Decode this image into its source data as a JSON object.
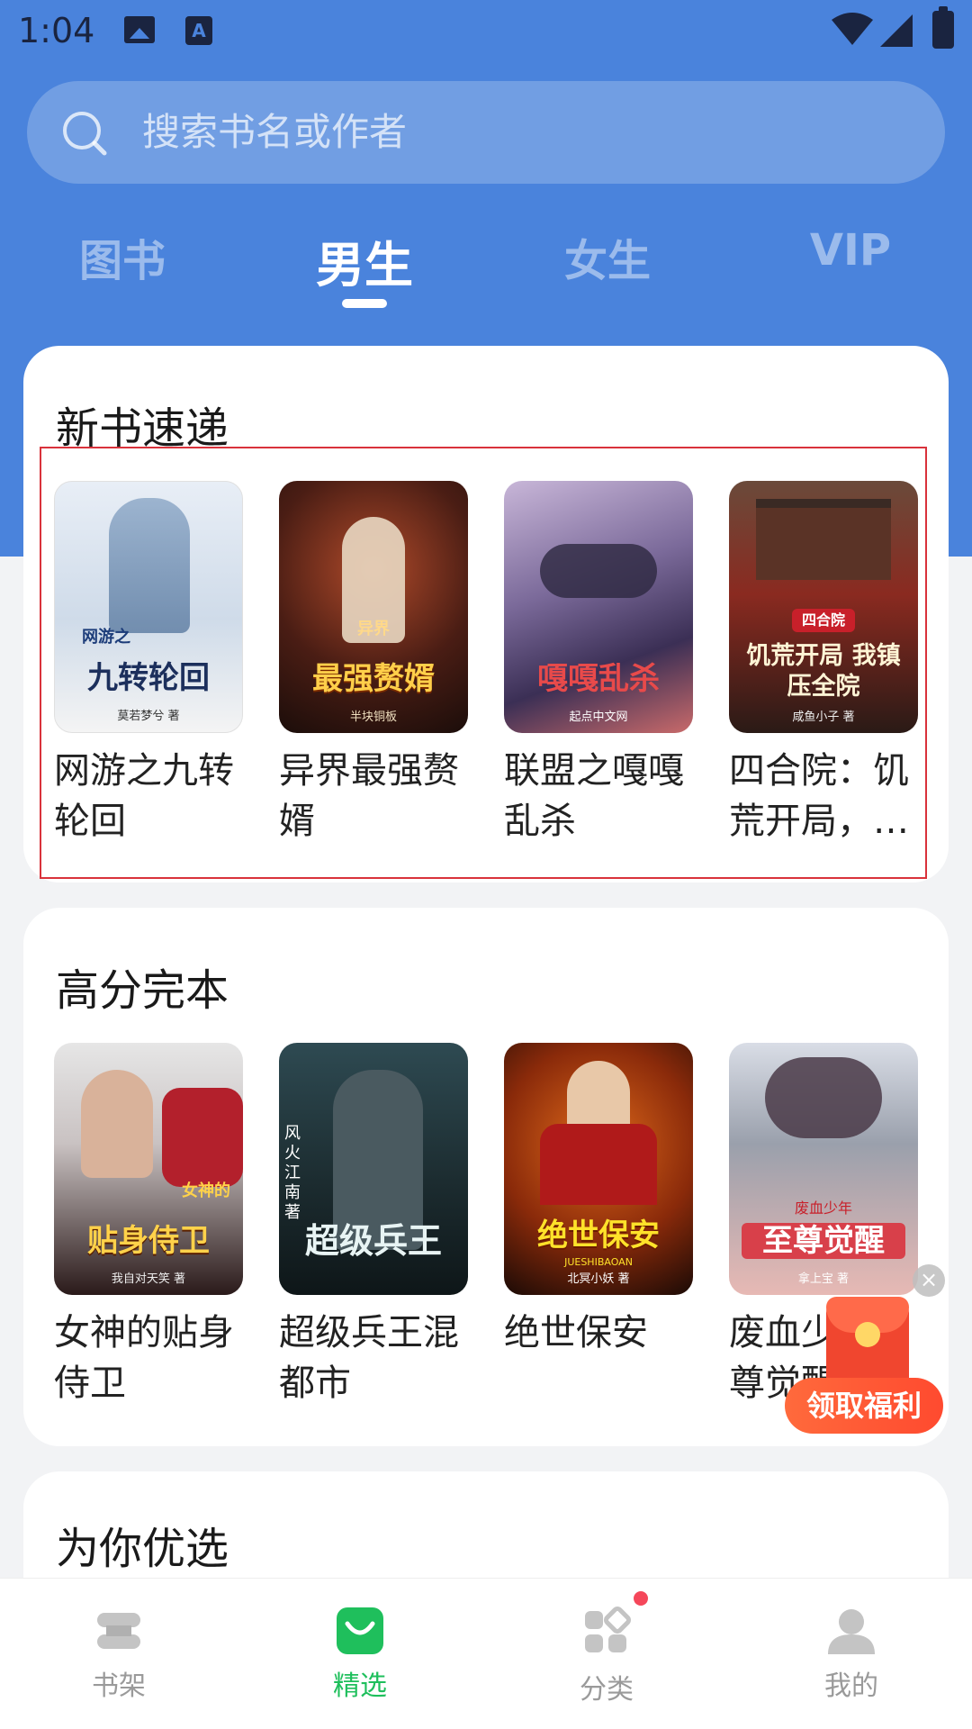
{
  "status_bar": {
    "time": "1:04",
    "a_icon_label": "A"
  },
  "search": {
    "placeholder": "搜索书名或作者"
  },
  "tabs": [
    {
      "label": "图书",
      "active": false
    },
    {
      "label": "男生",
      "active": true
    },
    {
      "label": "女生",
      "active": false
    },
    {
      "label": "VIP",
      "active": false
    }
  ],
  "sections": {
    "new_books": {
      "title": "新书速递",
      "books": [
        {
          "name": "网游之九转轮回",
          "cover_text": "九转轮回",
          "cover_sub": "网游之",
          "cover_author": "莫若梦兮 著"
        },
        {
          "name": "异界最强赘婿",
          "cover_text": "最强赘婿",
          "cover_sub": "异界",
          "cover_author": "半块铜板"
        },
        {
          "name": "联盟之嘎嘎乱杀",
          "cover_text": "嘎嘎乱杀",
          "cover_sub": "",
          "cover_author": "起点中文网"
        },
        {
          "name": "四合院：饥荒开局，…",
          "cover_text": "饥荒开局 我镇压全院",
          "cover_sub": "四合院",
          "cover_author": "咸鱼小子 著"
        }
      ]
    },
    "high_score": {
      "title": "高分完本",
      "books": [
        {
          "name": "女神的贴身侍卫",
          "cover_text": "贴身侍卫",
          "cover_sub": "女神的",
          "cover_author": "我自对天笑 著"
        },
        {
          "name": "超级兵王混都市",
          "cover_text": "超级兵王",
          "cover_sub": "风火江南 著",
          "cover_author": ""
        },
        {
          "name": "绝世保安",
          "cover_text": "绝世保安",
          "cover_sub": "JUESHIBAOAN",
          "cover_author": "北冥小妖 著"
        },
        {
          "name": "废血少年至尊觉醒",
          "cover_text": "至尊觉醒",
          "cover_sub": "废血少年",
          "cover_author": "拿上宝 著"
        }
      ]
    },
    "for_you": {
      "title": "为你优选"
    }
  },
  "floating": {
    "benefit_label": "领取福利",
    "close_label": "×"
  },
  "bottom_nav": [
    {
      "label": "书架",
      "icon": "bookshelf-icon",
      "active": false
    },
    {
      "label": "精选",
      "icon": "featured-bag-icon",
      "active": true
    },
    {
      "label": "分类",
      "icon": "category-icon",
      "active": false,
      "badge": true
    },
    {
      "label": "我的",
      "icon": "profile-icon",
      "active": false
    }
  ],
  "colors": {
    "header_blue": "#4a83dc",
    "active_green": "#1fbf5c",
    "highlight_red": "#d9323b",
    "benefit_orange": "#ff5a36"
  }
}
